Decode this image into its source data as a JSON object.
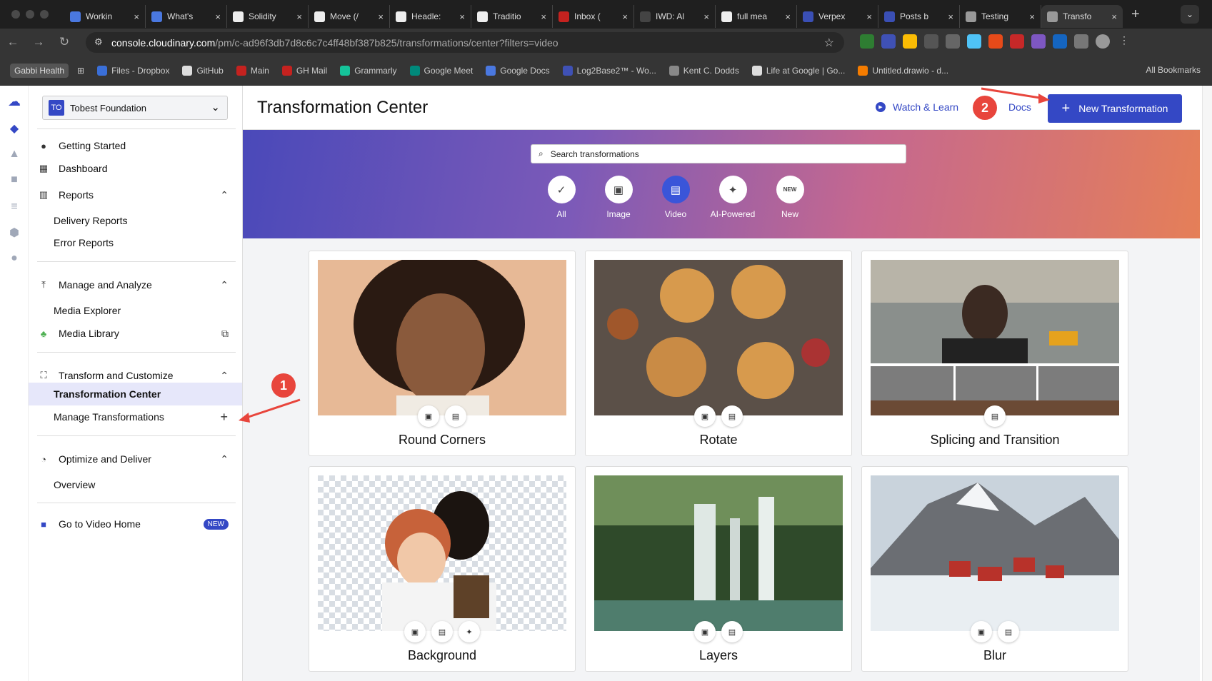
{
  "browser": {
    "tabs": [
      {
        "label": "Workin",
        "color": "#4a78e0"
      },
      {
        "label": "What's",
        "color": "#4a78e0"
      },
      {
        "label": "Solidity",
        "color": "#eee"
      },
      {
        "label": "Move (/",
        "color": "#eee"
      },
      {
        "label": "Headle:",
        "color": "#eee"
      },
      {
        "label": "Traditio",
        "color": "#eee"
      },
      {
        "label": "Inbox (",
        "color": "#c5221f"
      },
      {
        "label": "IWD: Al",
        "color": "#444"
      },
      {
        "label": "full mea",
        "color": "#eee"
      },
      {
        "label": "Verpex",
        "color": "#3a4fb5"
      },
      {
        "label": "Posts b",
        "color": "#3a4fb5"
      },
      {
        "label": "Testing",
        "color": "#999"
      },
      {
        "label": "Transfo",
        "color": "#999"
      }
    ],
    "url_domain": "console.cloudinary.com",
    "url_path": "/pm/c-ad96f3db7d8c6c7c4ff48bf387b825/transformations/center?filters=video",
    "bookmarks": [
      "Files - Dropbox",
      "GitHub",
      "Main",
      "GH Mail",
      "Grammarly",
      "Google Meet",
      "Google Docs",
      "Log2Base2™ - Wo...",
      "Kent C. Dodds",
      "Life at Google | Go...",
      "Untitled.drawio - d..."
    ],
    "gabbi_label": "Gabbi Health",
    "all_bookmarks": "All Bookmarks"
  },
  "sidebar": {
    "org_initials": "TO",
    "org_name": "Tobest Foundation",
    "getting_started": "Getting Started",
    "dashboard": "Dashboard",
    "reports": "Reports",
    "delivery_reports": "Delivery Reports",
    "error_reports": "Error Reports",
    "manage_analyze": "Manage and Analyze",
    "media_explorer": "Media Explorer",
    "media_library": "Media Library",
    "transform_customize": "Transform and Customize",
    "transformation_center": "Transformation Center",
    "manage_transformations": "Manage Transformations",
    "optimize_deliver": "Optimize and Deliver",
    "overview": "Overview",
    "go_video_home": "Go to Video Home",
    "new_badge": "NEW"
  },
  "header": {
    "title": "Transformation Center",
    "watch_learn": "Watch & Learn",
    "docs": "Docs",
    "new_transformation": "New Transformation"
  },
  "hero": {
    "search_placeholder": "Search transformations",
    "filters": [
      "All",
      "Image",
      "Video",
      "AI-Powered",
      "New"
    ],
    "selected_filter": "Video"
  },
  "cards": [
    {
      "title": "Round Corners",
      "chips": [
        "image",
        "video"
      ]
    },
    {
      "title": "Rotate",
      "chips": [
        "image",
        "video"
      ]
    },
    {
      "title": "Splicing and Transition",
      "chips": [
        "video"
      ]
    },
    {
      "title": "Background",
      "chips": [
        "image",
        "video",
        "ai"
      ]
    },
    {
      "title": "Layers",
      "chips": [
        "image",
        "video"
      ]
    },
    {
      "title": "Blur",
      "chips": [
        "image",
        "video"
      ]
    }
  ],
  "callouts": [
    "1",
    "2"
  ],
  "colors": {
    "accent": "#3448c5",
    "callout": "#e8453c"
  }
}
